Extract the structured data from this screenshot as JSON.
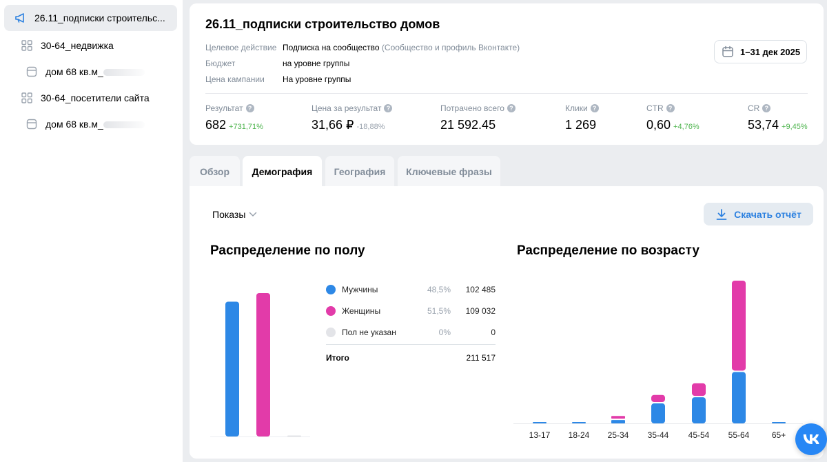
{
  "sidebar": {
    "items": [
      {
        "label": "26.11_подписки строительс...",
        "icon": "megaphone-icon",
        "active": true
      },
      {
        "label": "30-64_недвижка",
        "icon": "grid-icon"
      },
      {
        "label": "дом 68 кв.м_",
        "icon": "ad-card-icon"
      },
      {
        "label": "30-64_посетители сайта",
        "icon": "grid-icon"
      },
      {
        "label": "дом 68 кв.м_",
        "icon": "ad-card-icon"
      }
    ]
  },
  "campaign": {
    "title": "26.11_подписки строительство домов",
    "meta": [
      {
        "key": "Целевое действие",
        "value": "Подписка на сообщество",
        "extra": "(Сообщество и профиль Вконтакте)"
      },
      {
        "key": "Бюджет",
        "value": "на уровне группы"
      },
      {
        "key": "Цена кампании",
        "value": "На уровне группы"
      }
    ],
    "date_range": "1–31 дек 2025"
  },
  "metrics": [
    {
      "label": "Результат",
      "value": "682",
      "delta": "+731,71%",
      "delta_type": "pos"
    },
    {
      "label": "Цена за результат",
      "value": "31,66 ₽",
      "delta": "-18,88%",
      "delta_type": "neg"
    },
    {
      "label": "Потрачено всего",
      "value": "21 592.45",
      "delta": "",
      "delta_type": ""
    },
    {
      "label": "Клики",
      "value": "1 269",
      "delta": "",
      "delta_type": ""
    },
    {
      "label": "CTR",
      "value": "0,60",
      "delta": "+4,76%",
      "delta_type": "pos"
    },
    {
      "label": "CR",
      "value": "53,74",
      "delta": "+9,45%",
      "delta_type": "pos"
    }
  ],
  "tabs": [
    {
      "label": "Обзор",
      "active": false
    },
    {
      "label": "Демография",
      "active": true
    },
    {
      "label": "География",
      "active": false
    },
    {
      "label": "Ключевые фразы",
      "active": false
    }
  ],
  "controls": {
    "metric_select": "Показы",
    "download_label": "Скачать отчёт"
  },
  "colors": {
    "male": "#2d88e6",
    "female": "#e23ba9",
    "unknown": "#e3e4e8",
    "accent": "#2d81e0",
    "positive": "#4bb34b"
  },
  "gender": {
    "title": "Распределение по полу",
    "legend": [
      {
        "name": "Мужчины",
        "pct": "48,5%",
        "value": "102 485",
        "color": "#2d88e6"
      },
      {
        "name": "Женщины",
        "pct": "51,5%",
        "value": "109 032",
        "color": "#e23ba9"
      },
      {
        "name": "Пол не указан",
        "pct": "0%",
        "value": "0",
        "color": "#e3e4e8"
      }
    ],
    "total_label": "Итого",
    "total_value": "211 517"
  },
  "age": {
    "title": "Распределение по возрасту"
  },
  "chart_data": [
    {
      "type": "bar",
      "categories": [
        "Мужчины",
        "Женщины",
        "Пол не указан"
      ],
      "values": [
        102485,
        109032,
        0
      ]
    },
    {
      "type": "bar",
      "stacked": true,
      "categories": [
        "13-17",
        "18-24",
        "25-34",
        "35-44",
        "45-54",
        "55-64",
        "65+"
      ],
      "series": [
        {
          "name": "Мужчины",
          "values": [
            100,
            120,
            2200,
            13200,
            17300,
            34000,
            200
          ]
        },
        {
          "name": "Женщины",
          "values": [
            0,
            0,
            1800,
            4700,
            8300,
            59500,
            0
          ]
        }
      ]
    }
  ]
}
